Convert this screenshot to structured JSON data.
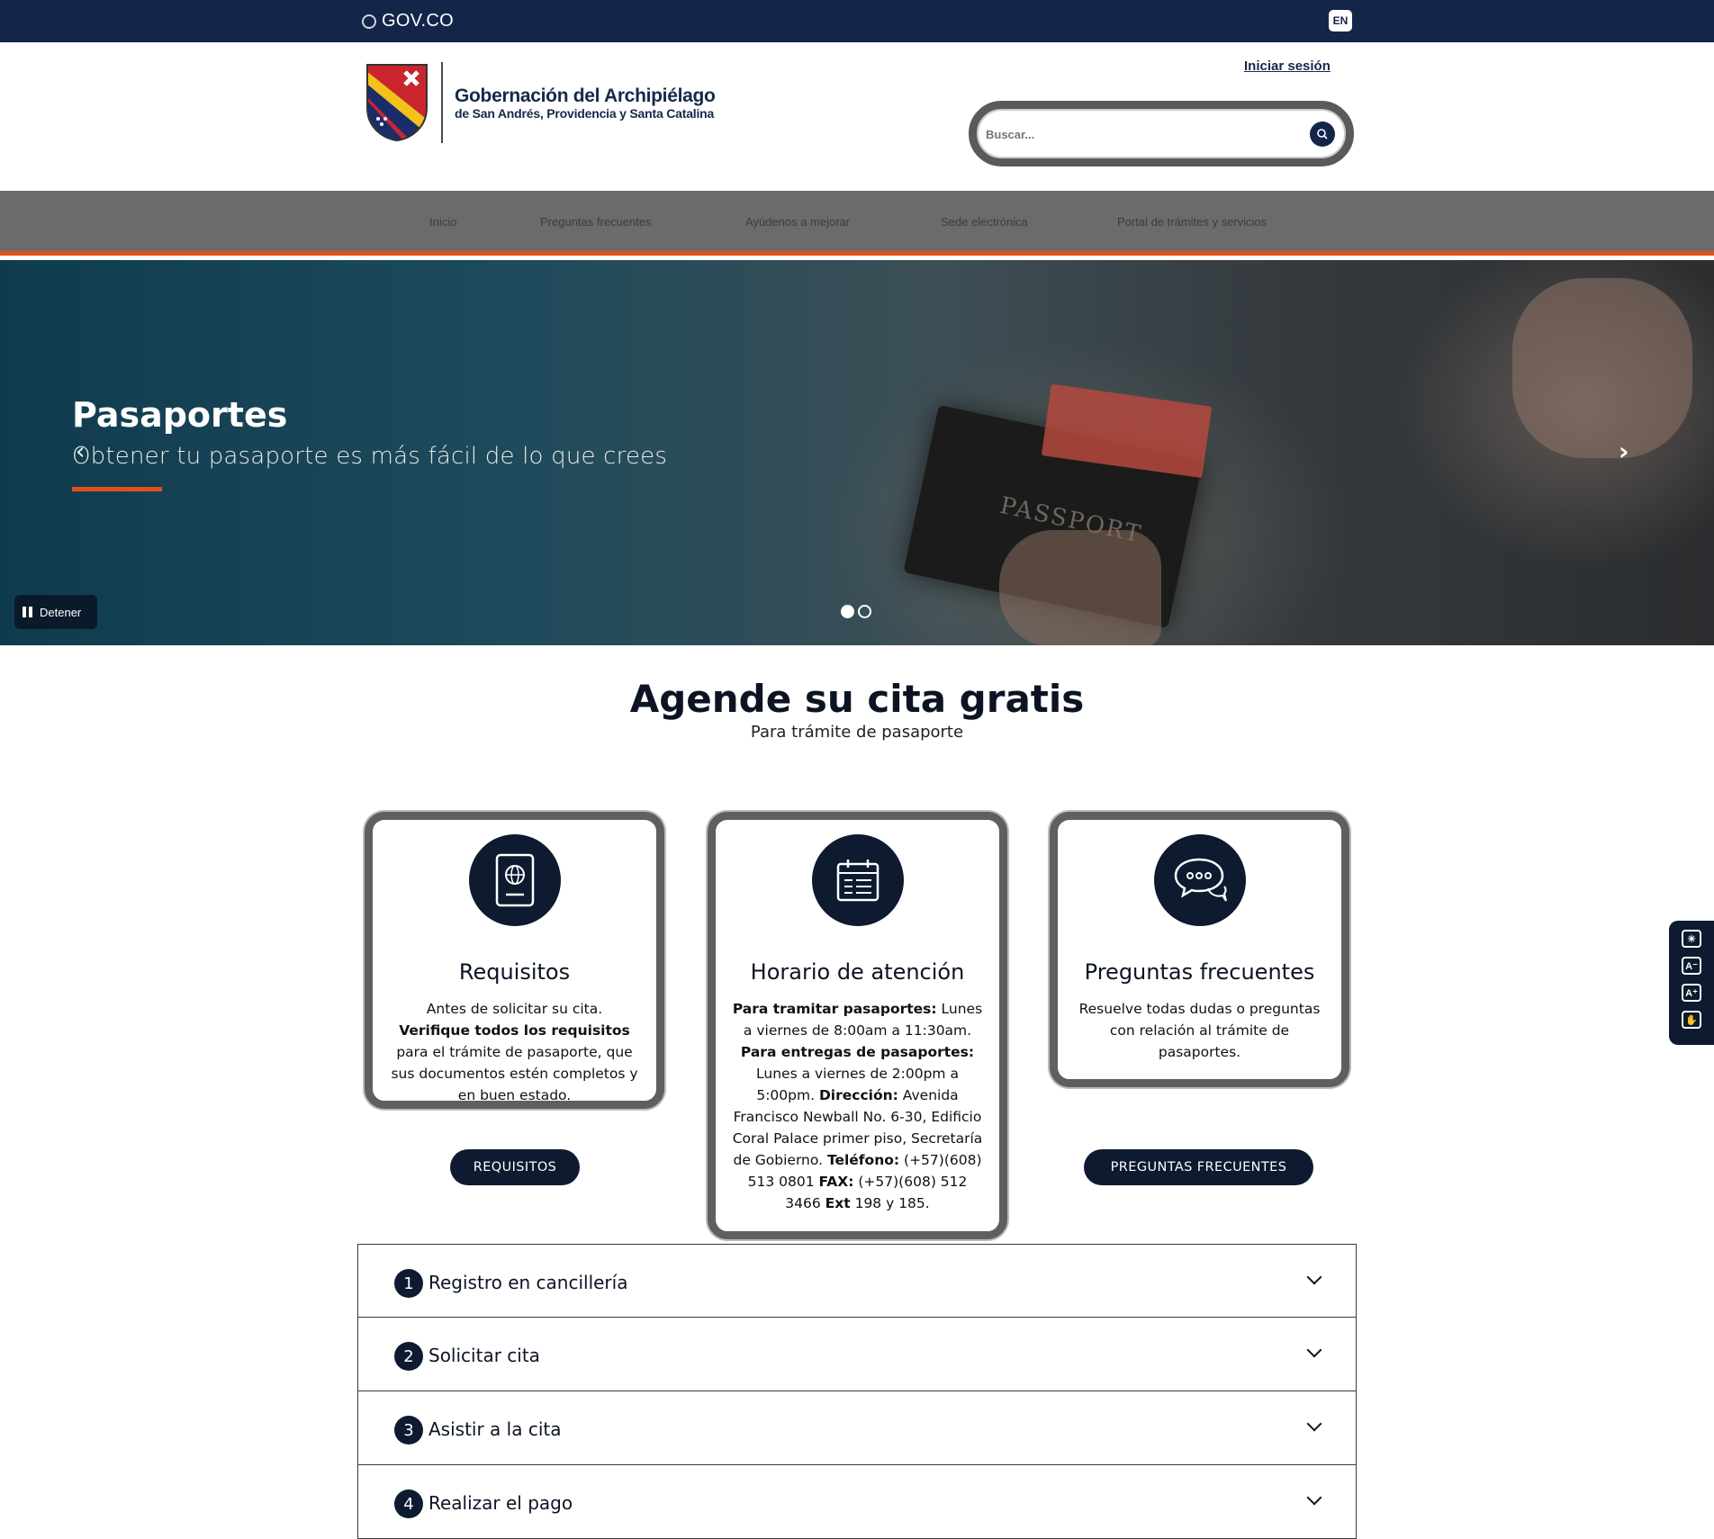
{
  "govbar": {
    "logo_text": "GOV.CO",
    "lang_button": "EN"
  },
  "header": {
    "brand_title": "Gobernación del Archipiélago",
    "brand_subtitle": "de San Andrés, Providencia y Santa Catalina",
    "login_link": "Iniciar sesión",
    "search": {
      "placeholder": "Buscar..."
    }
  },
  "nav": {
    "items": [
      "Inicio",
      "Preguntas frecuentes",
      "Ayúdenos a mejorar",
      "Sede electrónica",
      "Portal de trámites y servicios"
    ]
  },
  "hero": {
    "title": "Pasaportes",
    "subtitle": "Obtener tu pasaporte es más fácil de lo que crees",
    "image_text": "PASSPORT",
    "pause_label": "Detener",
    "slides_total": 2,
    "active_slide": 1
  },
  "section": {
    "title": "Agende su cita gratis",
    "subtitle": "Para trámite de pasaporte"
  },
  "cards": [
    {
      "title": "Requisitos",
      "icon": "passport-icon",
      "body": [
        {
          "text": "Antes de solicitar su cita. ",
          "bold": false
        },
        {
          "text": "Verifique todos los requisitos",
          "bold": true
        },
        {
          "text": " para el trámite de pasaporte, que sus documentos estén completos y en buen estado.",
          "bold": false
        }
      ],
      "button": "REQUISITOS"
    },
    {
      "title": "Horario de atención",
      "icon": "calendar-icon",
      "body": [
        {
          "text": "Para tramitar pasaportes:",
          "bold": true
        },
        {
          "text": " Lunes a viernes de 8:00am a 11:30am. ",
          "bold": false
        },
        {
          "text": "Para entregas de pasaportes:",
          "bold": true
        },
        {
          "text": " Lunes a viernes de 2:00pm a 5:00pm. ",
          "bold": false
        },
        {
          "text": "Dirección:",
          "bold": true
        },
        {
          "text": " Avenida Francisco Newball No. 6-30, Edificio Coral Palace primer piso, Secretaría de Gobierno. ",
          "bold": false
        },
        {
          "text": "Teléfono:",
          "bold": true
        },
        {
          "text": " (+57)(608) 513 0801 ",
          "bold": false
        },
        {
          "text": "FAX:",
          "bold": true
        },
        {
          "text": " (+57)(608) 512 3466 ",
          "bold": false
        },
        {
          "text": "Ext",
          "bold": true
        },
        {
          "text": " 198 y 185.",
          "bold": false
        }
      ]
    },
    {
      "title": "Preguntas frecuentes",
      "icon": "chat-bubbles-icon",
      "body": [
        {
          "text": "Resuelve todas dudas o preguntas con relación al trámite de pasaportes.",
          "bold": false
        }
      ],
      "button": "PREGUNTAS FRECUENTES"
    }
  ],
  "accordion": [
    {
      "number": "1",
      "label": "Registro en cancillería"
    },
    {
      "number": "2",
      "label": "Solicitar cita"
    },
    {
      "number": "3",
      "label": "Asistir a la cita"
    },
    {
      "number": "4",
      "label": "Realizar el pago"
    }
  ],
  "accessibility": {
    "tools": [
      "contrast-icon",
      "decrease-font-icon",
      "increase-font-icon",
      "sign-language-icon"
    ],
    "labels": [
      "☀",
      "A⁻",
      "A⁺",
      "✋"
    ]
  },
  "colors": {
    "navy": "#14254a",
    "dark": "#0d1a2f",
    "accent": "#e0501d",
    "nav_bg": "#6b6b6b"
  }
}
